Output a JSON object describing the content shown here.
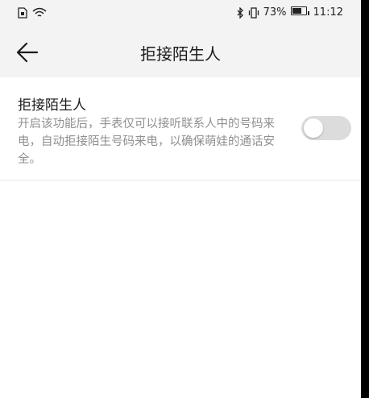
{
  "status_bar": {
    "time": "11:12",
    "battery_percent_text": "73%",
    "battery_level": 0.73,
    "icons": [
      "sim-card-icon",
      "wifi-icon",
      "bluetooth-icon",
      "vibrate-icon",
      "battery-icon"
    ]
  },
  "app_bar": {
    "title": "拒接陌生人",
    "back_icon": "arrow-left-icon"
  },
  "setting": {
    "title": "拒接陌生人",
    "description": "开启该功能后，手表仅可以接听联系人中的号码来电，自动拒接陌生号码来电，以确保萌娃的通话安全。",
    "enabled": false
  },
  "colors": {
    "bar_background": "#f3f3f3",
    "switch_off": "#dcdcdc"
  }
}
